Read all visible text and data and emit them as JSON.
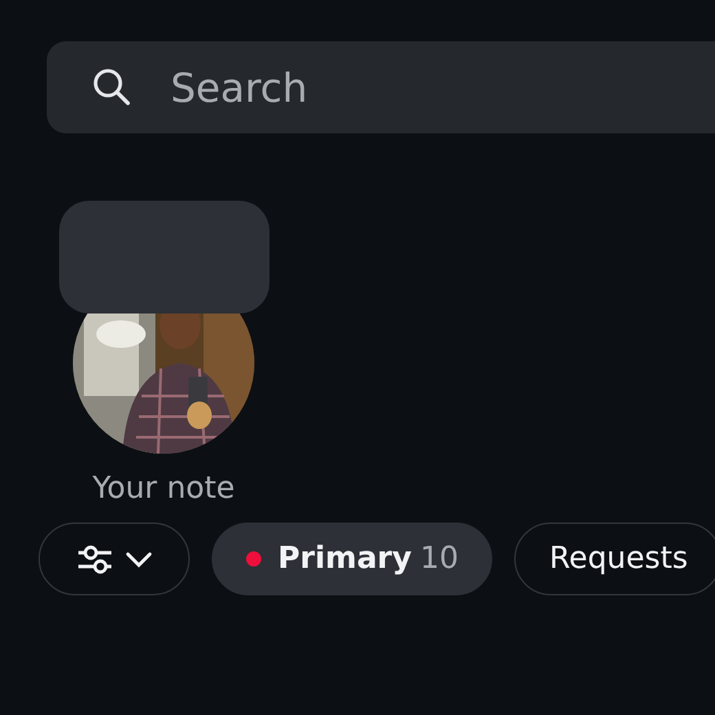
{
  "search": {
    "placeholder": "Search"
  },
  "note": {
    "label": "Your note"
  },
  "tabs": [
    {
      "label": "Primary",
      "count": "10",
      "unread": true,
      "selected": true
    },
    {
      "label": "Requests",
      "unread": false,
      "selected": false
    }
  ]
}
